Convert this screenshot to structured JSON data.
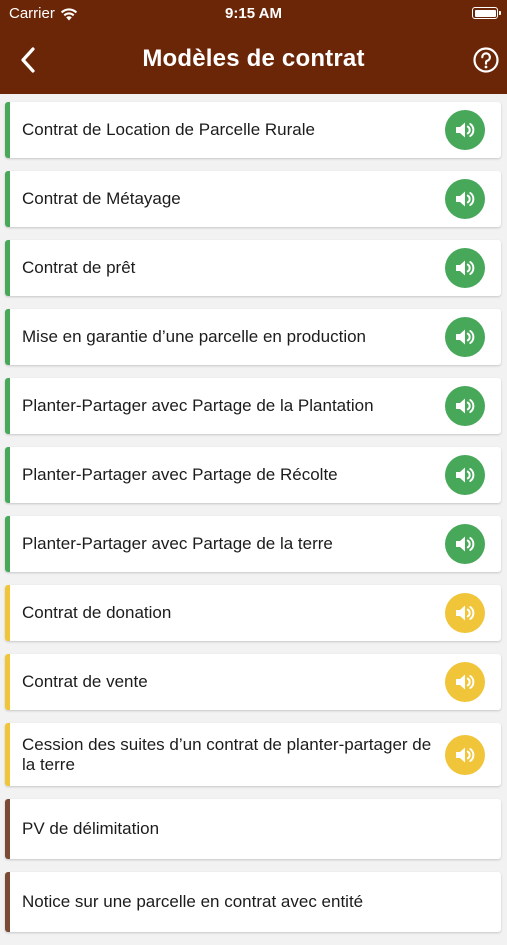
{
  "status_bar": {
    "carrier": "Carrier",
    "time": "9:15 AM"
  },
  "header": {
    "title": "Modèles de contrat",
    "back_icon": "chevron-left-icon",
    "help_icon": "help-circle-icon"
  },
  "colors": {
    "header_bg": "#6b2607",
    "green": "#47a85a",
    "yellow": "#f0c53a",
    "brown": "#7a4a35"
  },
  "contracts": [
    {
      "label": "Contrat de Location de Parcelle Rurale",
      "color": "green",
      "has_audio": true
    },
    {
      "label": "Contrat de Métayage",
      "color": "green",
      "has_audio": true
    },
    {
      "label": "Contrat de prêt",
      "color": "green",
      "has_audio": true
    },
    {
      "label": "Mise en garantie d’une parcelle en production",
      "color": "green",
      "has_audio": true
    },
    {
      "label": "Planter-Partager avec Partage de la Plantation",
      "color": "green",
      "has_audio": true
    },
    {
      "label": "Planter-Partager avec Partage de Récolte",
      "color": "green",
      "has_audio": true
    },
    {
      "label": "Planter-Partager avec Partage de la terre",
      "color": "green",
      "has_audio": true
    },
    {
      "label": "Contrat de donation",
      "color": "yellow",
      "has_audio": true
    },
    {
      "label": "Contrat de vente",
      "color": "yellow",
      "has_audio": true
    },
    {
      "label": "Cession des suites d’un contrat de planter-partager de la terre",
      "color": "yellow",
      "has_audio": true
    },
    {
      "label": "PV de délimitation",
      "color": "brown",
      "has_audio": false
    },
    {
      "label": "Notice sur une parcelle en contrat avec entité",
      "color": "brown",
      "has_audio": false
    }
  ]
}
